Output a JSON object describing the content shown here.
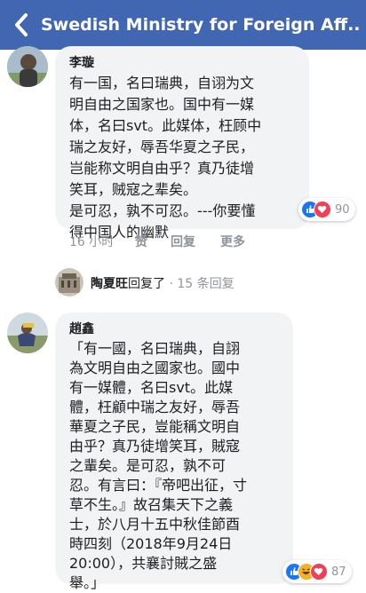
{
  "header": {
    "title": "Swedish Ministry for Foreign Aff..."
  },
  "comment1": {
    "author": "李璇",
    "lines": [
      "有一国，名曰瑞典，自诩为文",
      "明自由之国家也。国中有一媒",
      "体，名曰svt。此媒体，枉顾中",
      "瑞之友好，辱吾华夏之子民，",
      "岂能称文明自由乎？真乃徒增",
      "笑耳，贼寇之辈矣。",
      "是可忍，孰不可忍。---你要懂",
      "得中国人的幽默"
    ],
    "reactions_count": "90",
    "time": "16 小时",
    "like_label": "赞",
    "reply_label": "回复",
    "more_label": "更多",
    "reply_summary": {
      "replier": "陶夏旺",
      "action": "回复了",
      "count": "· 15 条回复"
    }
  },
  "comment2": {
    "author": "趙鑫",
    "lines": [
      "「有一國，名曰瑞典，自詡",
      "為文明自由之國家也。國中",
      "有一媒體，名曰svt。此媒",
      "體，枉顧中瑞之友好，辱吾",
      "華夏之子民，豈能稱文明自",
      "由乎？真乃徒增笑耳，賊寇",
      "之輩矣。是可忍，孰不可",
      "忍。有言曰：『帝吧出征，寸",
      "草不生。』故召集天下之義",
      "士，於八月十五中秋佳節酉",
      "時四刻（2018年9月24日",
      "20:00），共襄討賊之盛",
      "舉。」"
    ],
    "reactions_count": "87"
  },
  "colors": {
    "header_bg": "#4267b2",
    "bubble_bg": "#f2f3f5",
    "like_blue": "#1877f2",
    "love_red": "#f33e58",
    "haha_yellow": "#f7b125"
  }
}
